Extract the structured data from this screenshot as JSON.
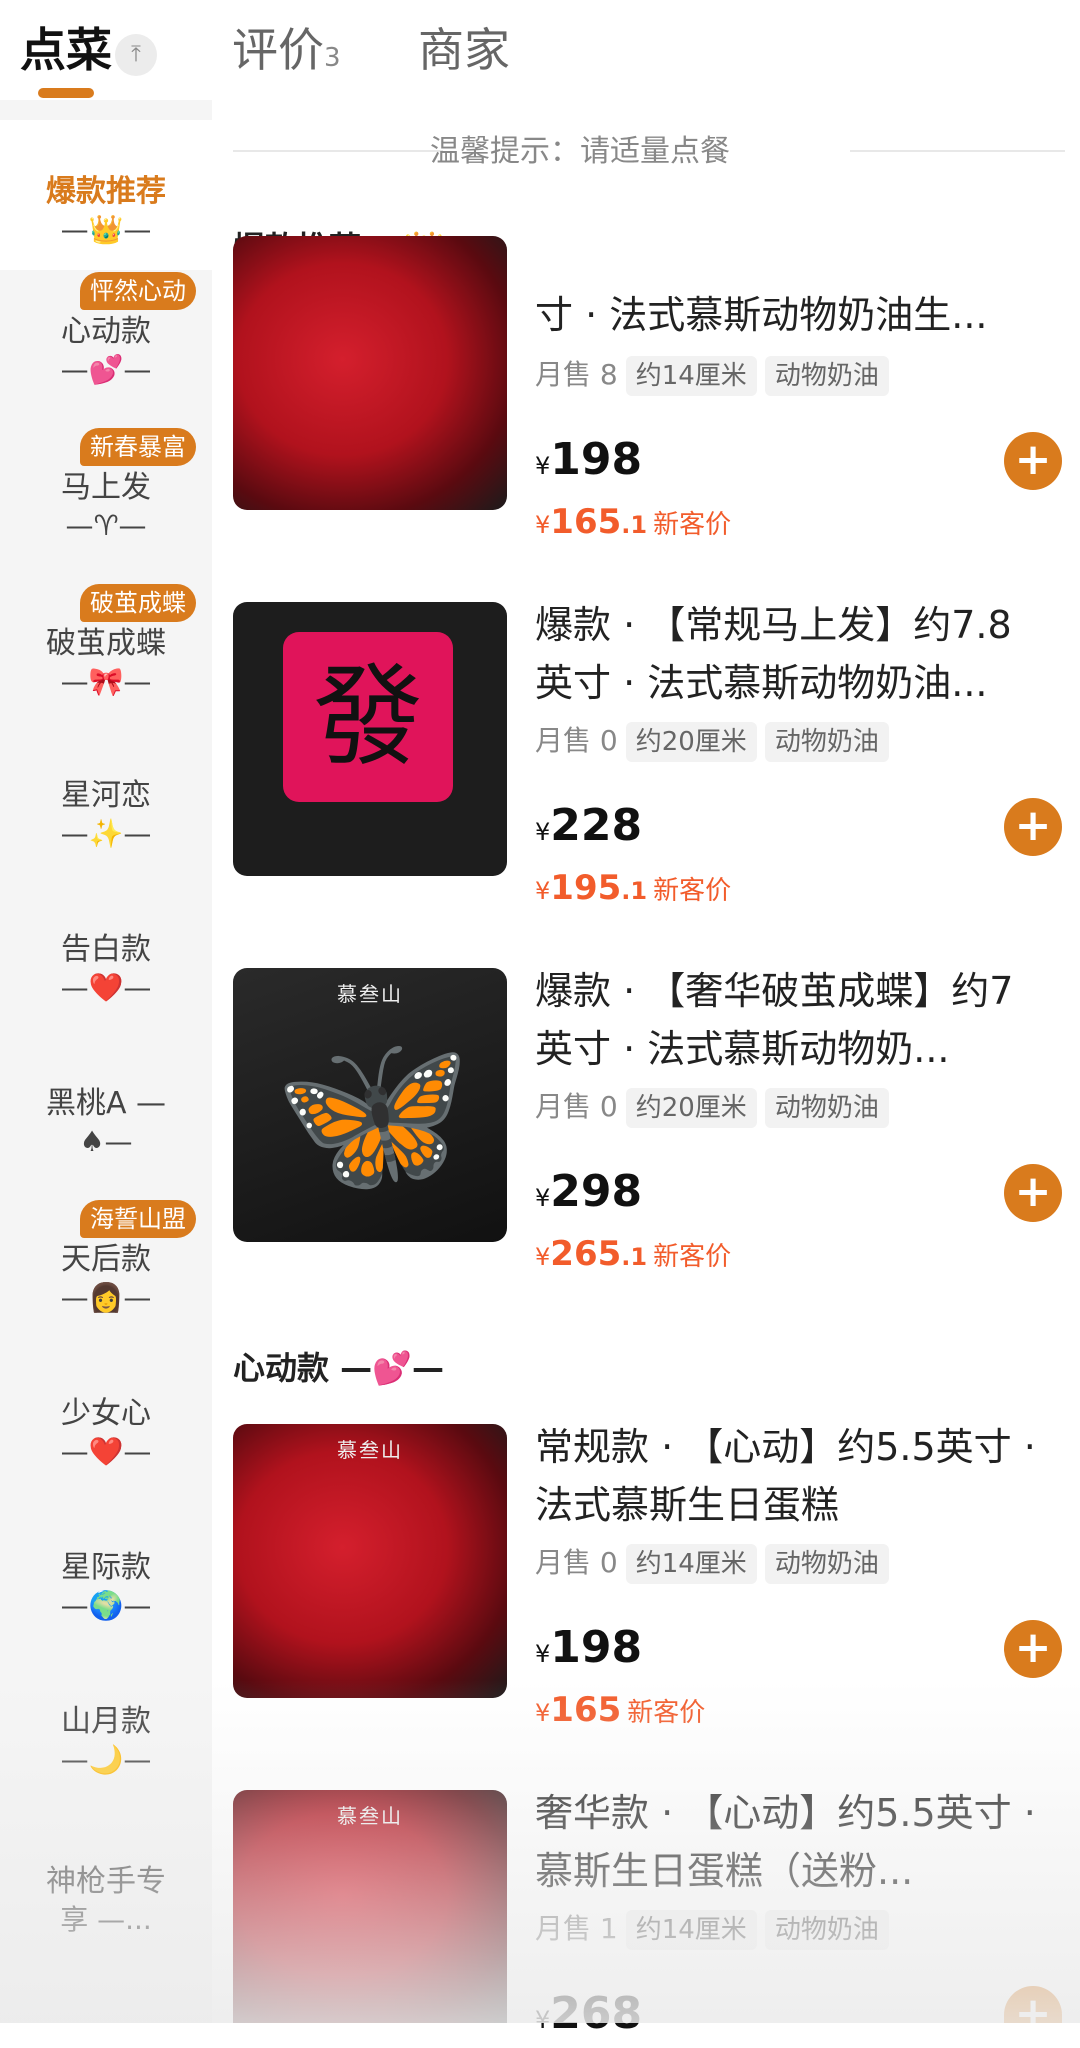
{
  "tabs": {
    "order": "点菜",
    "pin_icon": "arrow-to-top",
    "reviews": "评价",
    "reviews_count": "3",
    "shop": "商家"
  },
  "notice": "温馨提示：请适量点餐",
  "sidebar": {
    "items": [
      {
        "label": "爆款推荐",
        "emoji": "—👑—",
        "badge": ""
      },
      {
        "label": "心动款",
        "emoji": "—💕—",
        "badge": "怦然心动"
      },
      {
        "label": "马上发",
        "emoji": "—♈—",
        "badge": "新春暴富"
      },
      {
        "label": "破茧成蝶",
        "emoji": "—🎀—",
        "badge": "破茧成蝶"
      },
      {
        "label": "星河恋",
        "emoji": "—✨—",
        "badge": ""
      },
      {
        "label": "告白款",
        "emoji": "—❤️—",
        "badge": ""
      },
      {
        "label": "黑桃A —",
        "emoji": "♠—",
        "badge": ""
      },
      {
        "label": "天后款",
        "emoji": "—👩—",
        "badge": "海誓山盟"
      },
      {
        "label": "少女心",
        "emoji": "—❤️—",
        "badge": ""
      },
      {
        "label": "星际款",
        "emoji": "—🌍—",
        "badge": ""
      },
      {
        "label": "山月款",
        "emoji": "—🌙—",
        "badge": ""
      },
      {
        "label": "神枪手专",
        "emoji": "享 —...",
        "badge": ""
      }
    ]
  },
  "sections": [
    {
      "title": "爆款推荐 —👑—"
    },
    {
      "title": "心动款 —💕—"
    }
  ],
  "products": [
    {
      "name": "寸 · 法式慕斯动物奶油生...",
      "sales": "月售 8",
      "size": "约14厘米",
      "cream": "动物奶油",
      "price": "198",
      "new_price_int": "165",
      "new_price_dec": ".1",
      "new_label": "新客价",
      "image": "heart-cake"
    },
    {
      "name": "爆款 · 【常规马上发】约7.8英寸 · 法式慕斯动物奶油...",
      "sales": "月售 0",
      "size": "约20厘米",
      "cream": "动物奶油",
      "price": "228",
      "new_price_int": "195",
      "new_price_dec": ".1",
      "new_label": "新客价",
      "image": "mahjong-cake",
      "tile_char": "發"
    },
    {
      "name": "爆款 · 【奢华破茧成蝶】约7英寸 · 法式慕斯动物奶...",
      "sales": "月售 0",
      "size": "约20厘米",
      "cream": "动物奶油",
      "price": "298",
      "new_price_int": "265",
      "new_price_dec": ".1",
      "new_label": "新客价",
      "image": "butterfly-cake",
      "brand": "慕叁山"
    },
    {
      "name": "常规款 · 【心动】约5.5英寸 · 法式慕斯生日蛋糕",
      "sales": "月售 0",
      "size": "约14厘米",
      "cream": "动物奶油",
      "price": "198",
      "new_price_int": "165",
      "new_price_dec": "",
      "new_label": "新客价",
      "image": "heart-cake",
      "brand": "慕叁山"
    },
    {
      "name": "奢华款 · 【心动】约5.5英寸 · 慕斯生日蛋糕（送粉...",
      "sales": "月售 1",
      "size": "约14厘米",
      "cream": "动物奶油",
      "price": "268",
      "image": "heart-cake",
      "brand": "慕叁山"
    }
  ],
  "currency": "¥",
  "add_icon": "+"
}
